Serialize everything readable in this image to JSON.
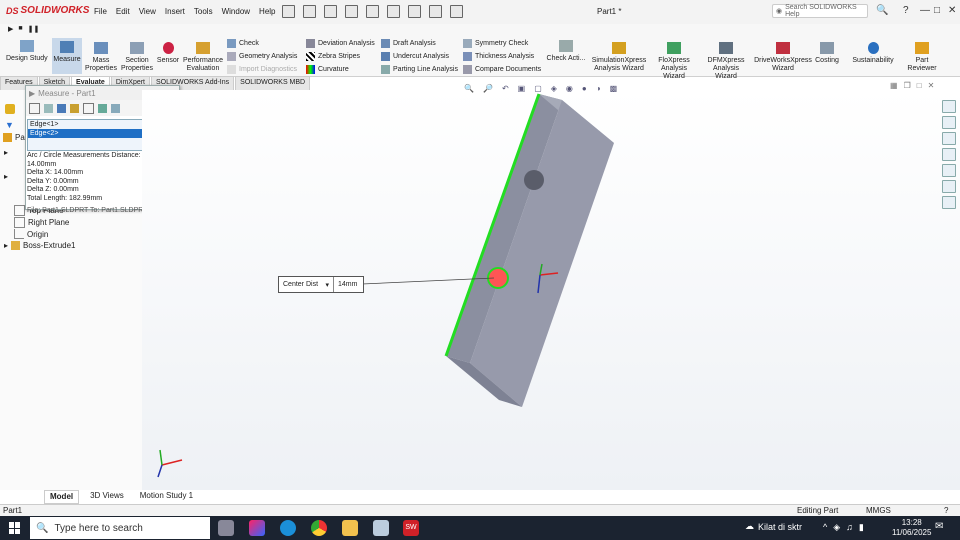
{
  "app": {
    "brand": "SOLIDWORKS",
    "doc_title": "Part1 *",
    "search_placeholder": "Search SOLIDWORKS Help"
  },
  "menu": [
    "File",
    "Edit",
    "View",
    "Insert",
    "Tools",
    "Window",
    "Help"
  ],
  "ribbon": {
    "large": [
      {
        "label": "Design Study",
        "icon": "design-study-icon"
      },
      {
        "label": "Measure",
        "icon": "measure-icon"
      },
      {
        "label": "Mass Properties",
        "icon": "mass-properties-icon"
      },
      {
        "label": "Section Properties",
        "icon": "section-properties-icon"
      },
      {
        "label": "Sensor",
        "icon": "sensor-icon"
      },
      {
        "label": "Performance Evaluation",
        "icon": "performance-icon"
      }
    ],
    "col1": [
      "Check",
      "Geometry Analysis",
      "Import Diagnostics"
    ],
    "col2": [
      "Deviation Analysis",
      "Zebra Stripes",
      "Curvature"
    ],
    "col3": [
      "Draft Analysis",
      "Undercut Analysis",
      "Parting Line Analysis"
    ],
    "col4": [
      "Symmetry Check",
      "Thickness Analysis",
      "Compare Documents"
    ],
    "check_active": "Check Acti...",
    "right": [
      {
        "label": "SimulationXpress Analysis Wizard"
      },
      {
        "label": "FloXpress Analysis Wizard"
      },
      {
        "label": "DFMXpress Analysis Wizard"
      },
      {
        "label": "DriveWorksXpress Wizard"
      },
      {
        "label": "Costing"
      },
      {
        "label": "Sustainability"
      },
      {
        "label": "Part Reviewer"
      }
    ]
  },
  "tabs": [
    "Features",
    "Sketch",
    "Evaluate",
    "DimXpert",
    "SOLIDWORKS Add-Ins",
    "SOLIDWORKS MBD"
  ],
  "active_tab": "Evaluate",
  "tree": {
    "part": "Par",
    "items": [
      "Top Plane",
      "Right Plane",
      "Origin",
      "Boss-Extrude1"
    ]
  },
  "measure": {
    "title": "Measure - Part1",
    "selections": [
      "Edge<1>",
      "Edge<2>"
    ],
    "results": [
      "Arc / Circle Measurements Distance: 14.00mm",
      "Delta X: 14.00mm",
      "Delta Y: 0.00mm",
      "Delta Z: 0.00mm",
      "Total Length: 182.99mm",
      "File: Part1.SLDPRT To: Part1.SLDPRT"
    ]
  },
  "callout": {
    "mode": "Center Dist",
    "value": "14mm"
  },
  "bottom_tabs": [
    "Model",
    "3D Views",
    "Motion Study 1"
  ],
  "status": {
    "left": "Part1",
    "mid": "Editing Part",
    "units": "MMGS"
  },
  "taskbar": {
    "search": "Type here to search",
    "weather": "Kilat di sktr",
    "time": "13:28",
    "date": "11/06/2025"
  },
  "colors": {
    "accent": "#1f6fc5",
    "brand": "#d02128",
    "edge_highlight": "#22dd22"
  }
}
